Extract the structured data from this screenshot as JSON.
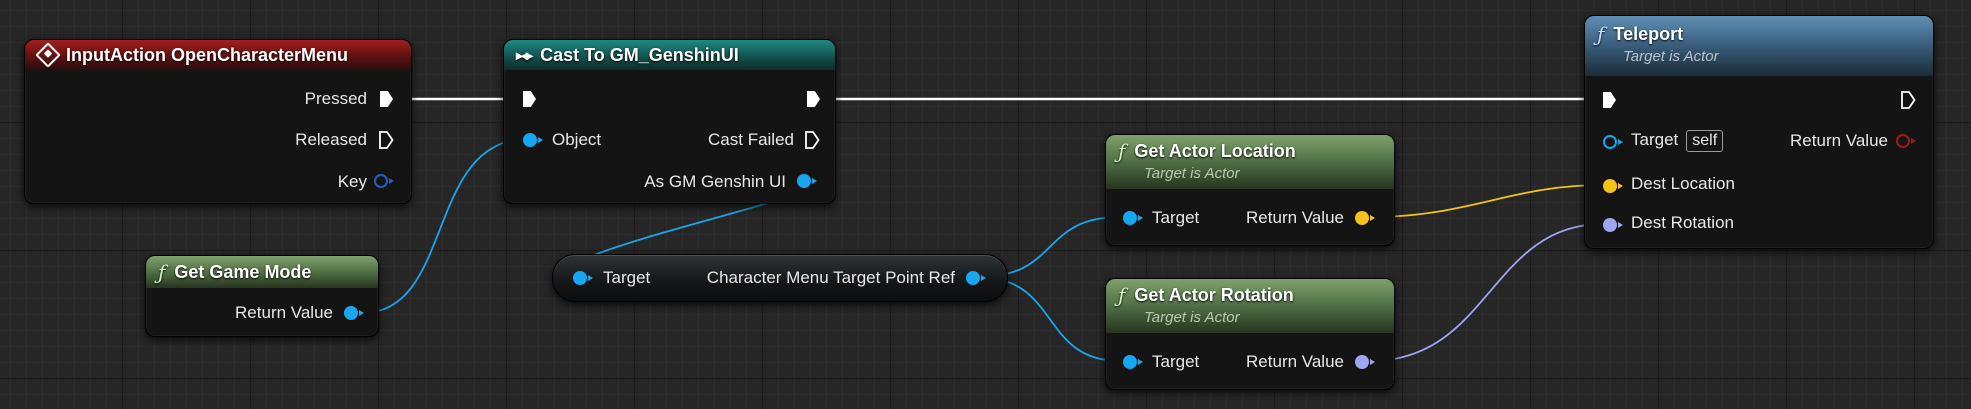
{
  "colors": {
    "exec": "#ffffff",
    "object_pin": "#16a7f0",
    "vector_pin": "#f2c318",
    "rotator_pin": "#9ea6f0",
    "error_pin": "#a01818",
    "event_header": "#a51e1e",
    "cast_header": "#1e8a86",
    "pure_function_header": "#5c7d4f",
    "function_header": "#4a7190"
  },
  "nodes": {
    "input_action": {
      "icon": "event-diamond-icon",
      "title": "InputAction OpenCharacterMenu",
      "pins": {
        "pressed": "Pressed",
        "released": "Released",
        "key": "Key"
      }
    },
    "cast": {
      "icon": "cast-arrows-icon",
      "title": "Cast To GM_GenshinUI",
      "pins": {
        "object": "Object",
        "cast_failed": "Cast Failed",
        "as_gm": "As GM Genshin UI"
      }
    },
    "get_game_mode": {
      "icon": "function-icon",
      "title": "Get Game Mode",
      "pins": {
        "return_value": "Return Value"
      }
    },
    "character_menu_ref": {
      "pins": {
        "target": "Target",
        "output": "Character Menu Target Point Ref"
      }
    },
    "get_actor_location": {
      "icon": "function-icon",
      "title": "Get Actor Location",
      "subtitle": "Target is Actor",
      "pins": {
        "target": "Target",
        "return_value": "Return Value"
      }
    },
    "get_actor_rotation": {
      "icon": "function-icon",
      "title": "Get Actor Rotation",
      "subtitle": "Target is Actor",
      "pins": {
        "target": "Target",
        "return_value": "Return Value"
      }
    },
    "teleport": {
      "icon": "function-icon",
      "title": "Teleport",
      "subtitle": "Target is Actor",
      "pins": {
        "target": "Target",
        "target_default": "self",
        "return_value": "Return Value",
        "dest_location": "Dest Location",
        "dest_rotation": "Dest Rotation"
      }
    }
  }
}
